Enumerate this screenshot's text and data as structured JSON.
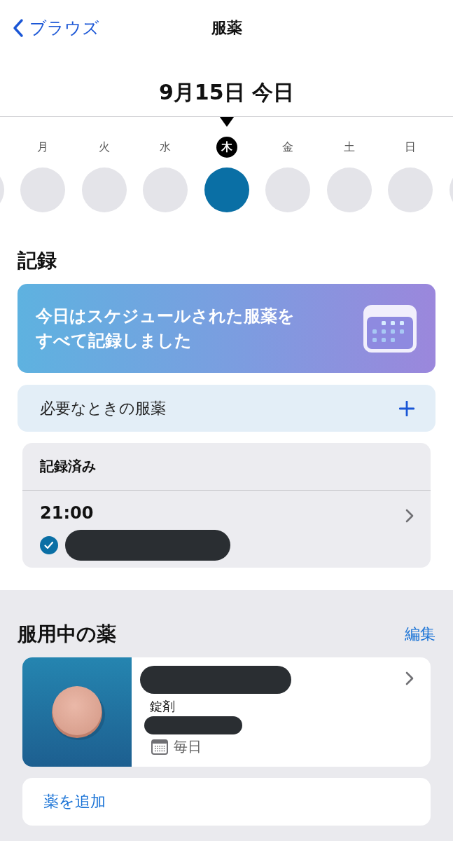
{
  "nav": {
    "back_label": "ブラウズ",
    "title": "服薬"
  },
  "date_title": "9月15日 今日",
  "week": [
    {
      "label": "月",
      "selected": false
    },
    {
      "label": "火",
      "selected": false
    },
    {
      "label": "水",
      "selected": false
    },
    {
      "label": "木",
      "selected": true
    },
    {
      "label": "金",
      "selected": false
    },
    {
      "label": "土",
      "selected": false
    },
    {
      "label": "日",
      "selected": false
    }
  ],
  "log": {
    "heading": "記録",
    "banner": "今日はスケジュールされた服薬をすべて記録しました",
    "as_needed": "必要なときの服薬",
    "logged": {
      "heading": "記録済み",
      "entries": [
        {
          "time": "21:00",
          "taken": true
        }
      ]
    }
  },
  "medications": {
    "heading": "服用中の薬",
    "edit": "編集",
    "items": [
      {
        "form": "錠剤",
        "schedule": "毎日"
      }
    ],
    "add": "薬を追加"
  }
}
